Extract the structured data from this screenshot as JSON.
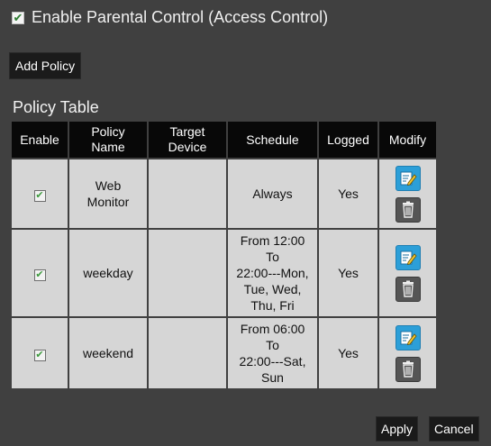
{
  "parental_control": {
    "checked": true,
    "label": "Enable Parental Control (Access Control)"
  },
  "add_policy_label": "Add Policy",
  "policy_table": {
    "title": "Policy Table",
    "headers": {
      "enable": "Enable",
      "policy_name_1": "Policy",
      "policy_name_2": "Name",
      "target_device_1": "Target",
      "target_device_2": "Device",
      "schedule": "Schedule",
      "logged": "Logged",
      "modify": "Modify"
    },
    "rows": [
      {
        "enabled": true,
        "name_lines": [
          "Web",
          "Monitor"
        ],
        "target_device": "",
        "schedule_lines": [
          "Always"
        ],
        "logged": "Yes"
      },
      {
        "enabled": true,
        "name_lines": [
          "weekday"
        ],
        "target_device": "",
        "schedule_lines": [
          "From 12:00",
          "To",
          "22:00---Mon,",
          "Tue, Wed,",
          "Thu, Fri"
        ],
        "logged": "Yes"
      },
      {
        "enabled": true,
        "name_lines": [
          "weekend"
        ],
        "target_device": "",
        "schedule_lines": [
          "From 06:00",
          "To",
          "22:00---Sat,",
          "Sun"
        ],
        "logged": "Yes"
      }
    ],
    "modify_icons": {
      "edit": "edit-icon",
      "delete": "trash-icon"
    }
  },
  "apply_label": "Apply",
  "cancel_label": "Cancel",
  "colors": {
    "background": "#404040",
    "header": "#080808",
    "cell": "#d6d6d6",
    "edit_blue": "#2c9fd8"
  }
}
